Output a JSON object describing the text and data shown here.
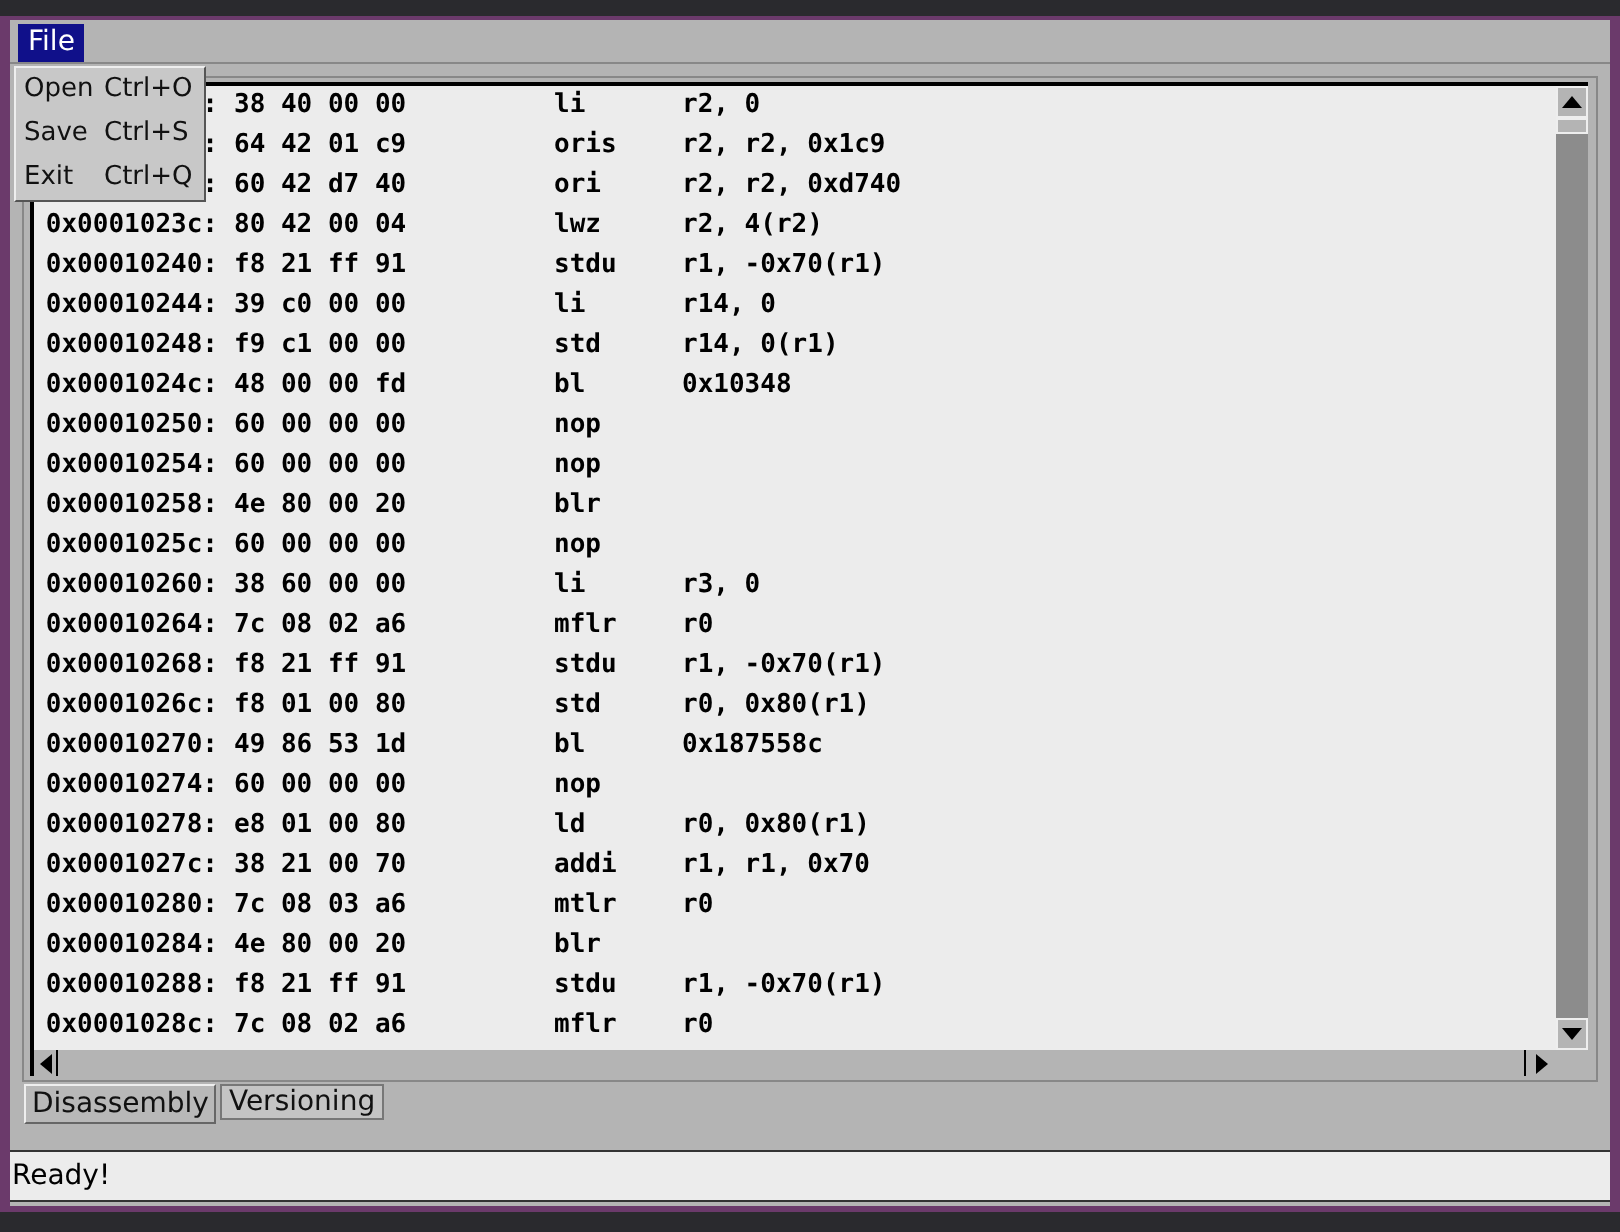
{
  "menubar": [
    {
      "label": "File",
      "selected": true
    }
  ],
  "menu": [
    {
      "label": "Open",
      "accel": "Ctrl+O"
    },
    {
      "label": "Save",
      "accel": "Ctrl+S"
    },
    {
      "label": "Exit",
      "accel": "Ctrl+Q"
    }
  ],
  "listing": [
    {
      "address": ":",
      "bytes": "38 40 00 00",
      "mnemonic": "li",
      "operands": "r2, 0"
    },
    {
      "address": ":",
      "bytes": "64 42 01 c9",
      "mnemonic": "oris",
      "operands": "r2, r2, 0x1c9"
    },
    {
      "address": ":",
      "bytes": "60 42 d7 40",
      "mnemonic": "ori",
      "operands": "r2, r2, 0xd740"
    },
    {
      "address": "0x0001023c:",
      "bytes": "80 42 00 04",
      "mnemonic": "lwz",
      "operands": "r2, 4(r2)"
    },
    {
      "address": "0x00010240:",
      "bytes": "f8 21 ff 91",
      "mnemonic": "stdu",
      "operands": "r1, -0x70(r1)"
    },
    {
      "address": "0x00010244:",
      "bytes": "39 c0 00 00",
      "mnemonic": "li",
      "operands": "r14, 0"
    },
    {
      "address": "0x00010248:",
      "bytes": "f9 c1 00 00",
      "mnemonic": "std",
      "operands": "r14, 0(r1)"
    },
    {
      "address": "0x0001024c:",
      "bytes": "48 00 00 fd",
      "mnemonic": "bl",
      "operands": "0x10348"
    },
    {
      "address": "0x00010250:",
      "bytes": "60 00 00 00",
      "mnemonic": "nop"
    },
    {
      "address": "0x00010254:",
      "bytes": "60 00 00 00",
      "mnemonic": "nop"
    },
    {
      "address": "0x00010258:",
      "bytes": "4e 80 00 20",
      "mnemonic": "blr"
    },
    {
      "address": "0x0001025c:",
      "bytes": "60 00 00 00",
      "mnemonic": "nop"
    },
    {
      "address": "0x00010260:",
      "bytes": "38 60 00 00",
      "mnemonic": "li",
      "operands": "r3, 0"
    },
    {
      "address": "0x00010264:",
      "bytes": "7c 08 02 a6",
      "mnemonic": "mflr",
      "operands": "r0"
    },
    {
      "address": "0x00010268:",
      "bytes": "f8 21 ff 91",
      "mnemonic": "stdu",
      "operands": "r1, -0x70(r1)"
    },
    {
      "address": "0x0001026c:",
      "bytes": "f8 01 00 80",
      "mnemonic": "std",
      "operands": "r0, 0x80(r1)"
    },
    {
      "address": "0x00010270:",
      "bytes": "49 86 53 1d",
      "mnemonic": "bl",
      "operands": "0x187558c"
    },
    {
      "address": "0x00010274:",
      "bytes": "60 00 00 00",
      "mnemonic": "nop"
    },
    {
      "address": "0x00010278:",
      "bytes": "e8 01 00 80",
      "mnemonic": "ld",
      "operands": "r0, 0x80(r1)"
    },
    {
      "address": "0x0001027c:",
      "bytes": "38 21 00 70",
      "mnemonic": "addi",
      "operands": "r1, r1, 0x70"
    },
    {
      "address": "0x00010280:",
      "bytes": "7c 08 03 a6",
      "mnemonic": "mtlr",
      "operands": "r0"
    },
    {
      "address": "0x00010284:",
      "bytes": "4e 80 00 20",
      "mnemonic": "blr"
    },
    {
      "address": "0x00010288:",
      "bytes": "f8 21 ff 91",
      "mnemonic": "stdu",
      "operands": "r1, -0x70(r1)"
    },
    {
      "address": "0x0001028c:",
      "bytes": "7c 08 02 a6",
      "mnemonic": "mflr",
      "operands": "r0"
    }
  ],
  "tabs": [
    {
      "label": "Disassembly",
      "selected": true
    },
    {
      "label": "Versioning",
      "selected": false
    }
  ],
  "status_bar": "Ready!"
}
